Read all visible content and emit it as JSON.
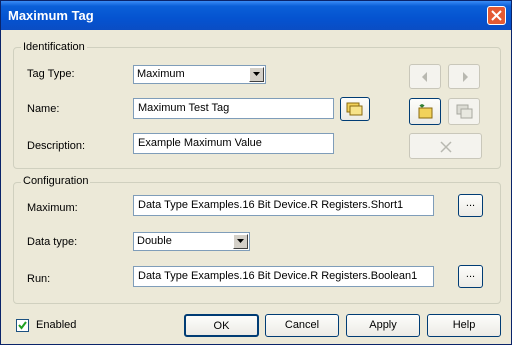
{
  "window": {
    "title": "Maximum Tag"
  },
  "identification": {
    "legend": "Identification",
    "tag_type_label": "Tag Type:",
    "tag_type_value": "Maximum",
    "name_label": "Name:",
    "name_value": "Maximum Test Tag",
    "description_label": "Description:",
    "description_value": "Example Maximum Value"
  },
  "configuration": {
    "legend": "Configuration",
    "maximum_label": "Maximum:",
    "maximum_value": "Data Type Examples.16 Bit Device.R Registers.Short1",
    "data_type_label": "Data type:",
    "data_type_value": "Double",
    "run_label": "Run:",
    "run_value": "Data Type Examples.16 Bit Device.R Registers.Boolean1",
    "browse_label": "..."
  },
  "footer": {
    "enabled_label": "Enabled",
    "enabled_checked": true,
    "ok_label": "OK",
    "cancel_label": "Cancel",
    "apply_label": "Apply",
    "help_label": "Help"
  },
  "icons": {
    "close": "close-icon",
    "prev": "arrow-left-icon",
    "next": "arrow-right-icon",
    "new": "new-tag-icon",
    "duplicate": "duplicate-icon",
    "delete": "delete-x-icon",
    "browse_name": "browse-tags-icon"
  },
  "colors": {
    "titlebar": "#0553d0",
    "dialog_bg": "#ece9d8",
    "close": "#e45a33"
  }
}
